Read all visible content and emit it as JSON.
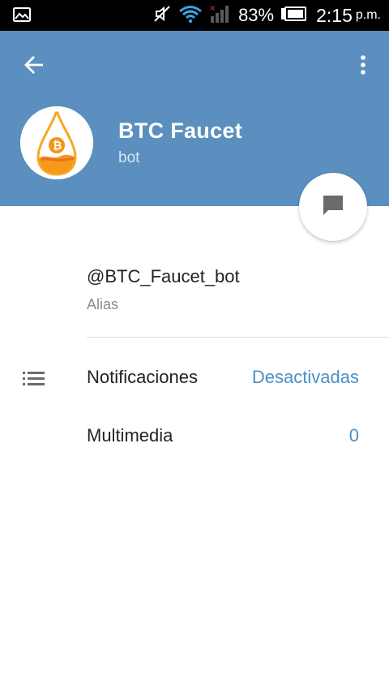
{
  "status_bar": {
    "battery_percent": "83%",
    "time": "2:15",
    "ampm": "p.m.",
    "icons": [
      "gallery-notification-icon",
      "mute-icon",
      "wifi-icon",
      "signal-icon",
      "battery-icon"
    ]
  },
  "header": {
    "title": "BTC Faucet",
    "subtitle": "bot",
    "colors": {
      "header_bg": "#5a8fbf",
      "accent": "#4a90c4"
    }
  },
  "profile": {
    "username": "@BTC_Faucet_bot",
    "username_caption": "Alias"
  },
  "settings": {
    "notifications": {
      "label": "Notificaciones",
      "value": "Desactivadas"
    },
    "media": {
      "label": "Multimedia",
      "value": "0"
    }
  }
}
